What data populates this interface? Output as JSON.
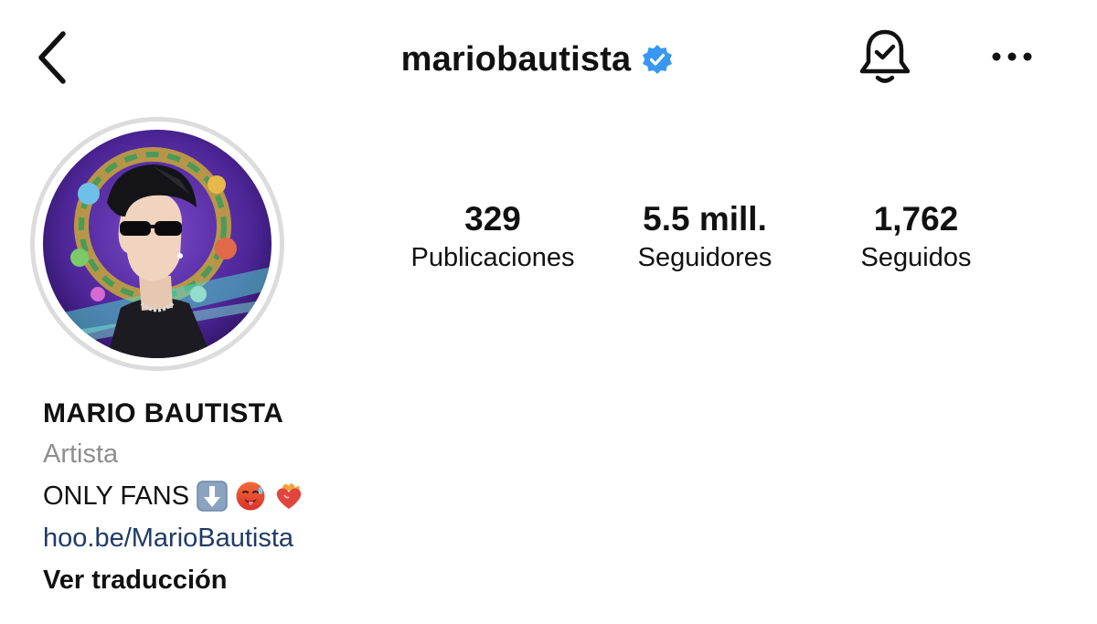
{
  "header": {
    "username": "mariobautista",
    "back_icon": "chevron-left-icon",
    "verified_icon": "verified-badge-icon",
    "bell_icon": "bell-check-icon",
    "more_icon": "more-horizontal-icon",
    "verified_color": "#3897f0"
  },
  "stats": {
    "posts": {
      "value": "329",
      "label": "Publicaciones"
    },
    "followers": {
      "value": "5.5 mill.",
      "label": "Seguidores"
    },
    "following": {
      "value": "1,762",
      "label": "Seguidos"
    }
  },
  "bio": {
    "name": "MARIO BAUTISTA",
    "category": "Artista",
    "text": "ONLY FANS",
    "emojis": [
      "down-arrow-emoji",
      "hot-face-emoji",
      "heart-on-fire-emoji"
    ],
    "link": "hoo.be/MarioBautista",
    "translate": "Ver traducción"
  },
  "colors": {
    "link": "#1f3b66",
    "category": "#8e8e8e",
    "avatar_ring": "#dcdcdc"
  }
}
